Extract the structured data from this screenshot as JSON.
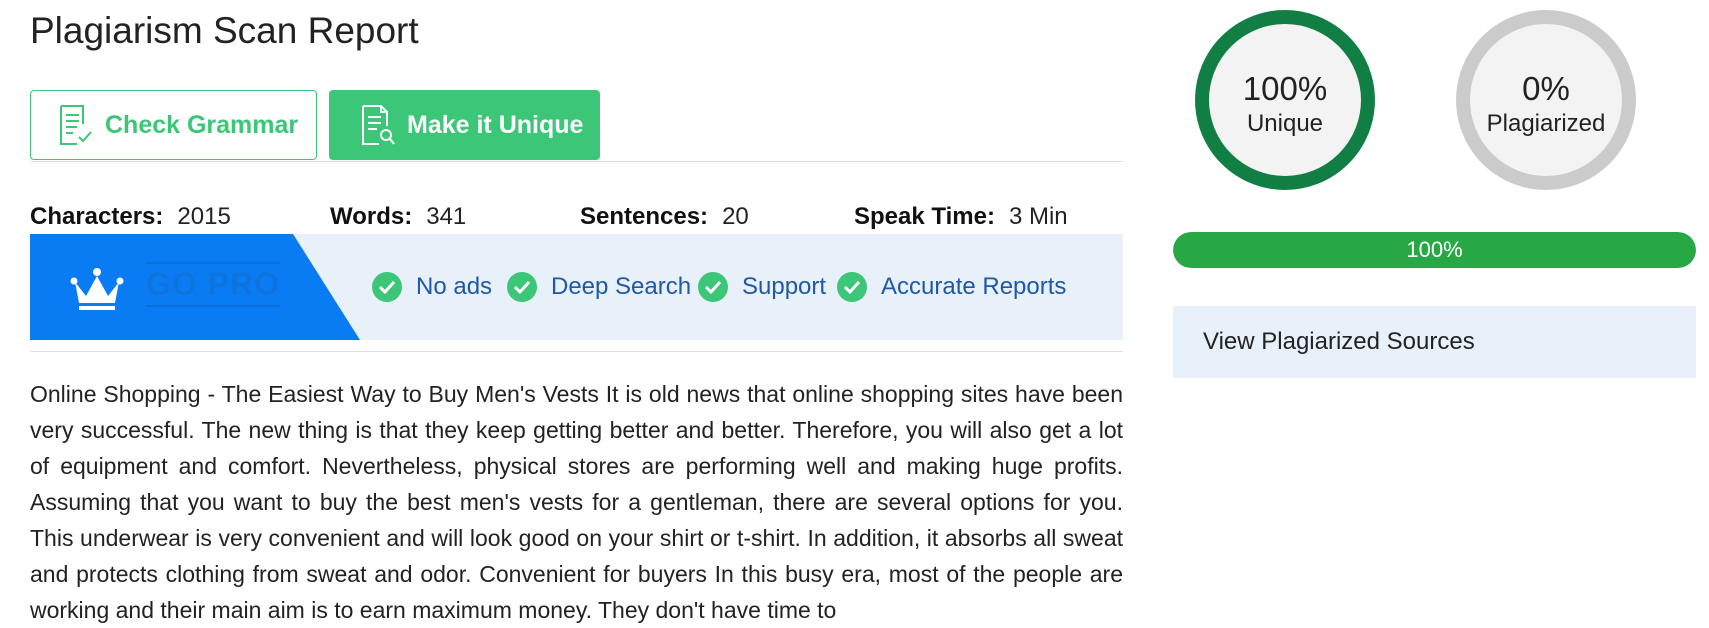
{
  "page": {
    "title": "Plagiarism Scan Report"
  },
  "buttons": {
    "check_grammar": "Check Grammar",
    "make_unique": "Make it Unique"
  },
  "stats": {
    "characters_label": "Characters:",
    "characters": "2015",
    "words_label": "Words:",
    "words": "341",
    "sentences_label": "Sentences:",
    "sentences": "20",
    "speak_time_label": "Speak Time:",
    "speak_time": "3 Min"
  },
  "promo": {
    "badge": "GO PRO",
    "features": [
      "No ads",
      "Deep Search",
      "Support",
      "Accurate Reports"
    ],
    "colors": {
      "blue": "#0a7cf3",
      "check": "#3cc677",
      "feature_text": "#1d59a8"
    }
  },
  "article": {
    "text": "Online Shopping - The Easiest Way to Buy Men's Vests It is old news that online shopping sites have been very successful. The new thing is that they keep getting better and better. Therefore, you will also get a lot of equipment and comfort. Nevertheless, physical stores are performing well and making huge profits. Assuming that you want to buy the best men's vests for a gentleman, there are several options for you. This underwear is very convenient and will look good on your shirt or t-shirt. In addition, it absorbs all sweat and protects clothing from sweat and odor. Convenient for buyers In this busy era, most of the people are working and their main aim is to earn maximum money. They don't have time to"
  },
  "results": {
    "unique_percent": "100%",
    "unique_label": "Unique",
    "plagiarized_percent": "0%",
    "plagiarized_label": "Plagiarized",
    "progress_value": 1.0,
    "progress_label": "100%",
    "colors": {
      "unique_ring": "#117f43",
      "plag_ring": "#cbcbcb",
      "progress": "#28a745"
    }
  },
  "sources": {
    "label": "View Plagiarized Sources"
  }
}
